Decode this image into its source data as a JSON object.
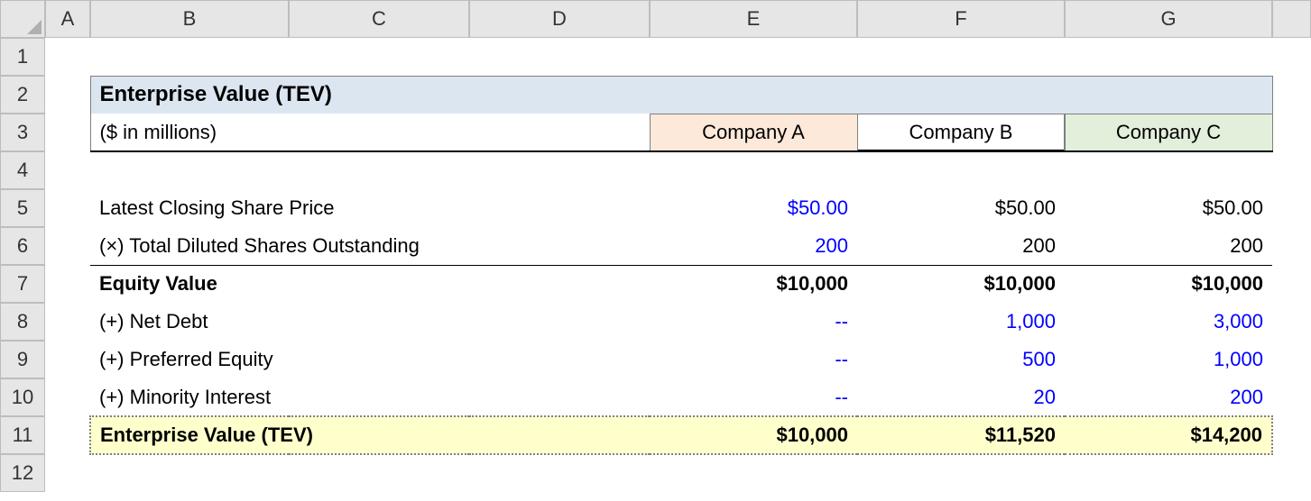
{
  "columns": [
    "A",
    "B",
    "C",
    "D",
    "E",
    "F",
    "G"
  ],
  "row_numbers": [
    "1",
    "2",
    "3",
    "4",
    "5",
    "6",
    "7",
    "8",
    "9",
    "10",
    "11",
    "12"
  ],
  "title": "Enterprise Value (TEV)",
  "subtitle": "($ in millions)",
  "companies": {
    "a": "Company A",
    "b": "Company B",
    "c": "Company C"
  },
  "rows": {
    "share_price": {
      "label": "Latest Closing Share Price",
      "a": "$50.00",
      "b": "$50.00",
      "c": "$50.00"
    },
    "shares": {
      "label": "(×) Total Diluted Shares Outstanding",
      "a": "200",
      "b": "200",
      "c": "200"
    },
    "equity": {
      "label": "Equity Value",
      "a": "$10,000",
      "b": "$10,000",
      "c": "$10,000"
    },
    "netdebt": {
      "label": "(+) Net Debt",
      "a": "--",
      "b": "1,000",
      "c": "3,000"
    },
    "pref": {
      "label": "(+) Preferred Equity",
      "a": "--",
      "b": "500",
      "c": "1,000"
    },
    "minority": {
      "label": "(+) Minority Interest",
      "a": "--",
      "b": "20",
      "c": "200"
    },
    "tev": {
      "label": "Enterprise Value (TEV)",
      "a": "$10,000",
      "b": "$11,520",
      "c": "$14,200"
    }
  },
  "chart_data": {
    "type": "table",
    "title": "Enterprise Value (TEV)",
    "unit": "$ in millions",
    "columns": [
      "Company A",
      "Company B",
      "Company C"
    ],
    "rows": [
      {
        "label": "Latest Closing Share Price",
        "values": [
          50.0,
          50.0,
          50.0
        ],
        "format": "currency2"
      },
      {
        "label": "(×) Total Diluted Shares Outstanding",
        "values": [
          200,
          200,
          200
        ]
      },
      {
        "label": "Equity Value",
        "values": [
          10000,
          10000,
          10000
        ],
        "format": "currency0",
        "bold": true
      },
      {
        "label": "(+) Net Debt",
        "values": [
          null,
          1000,
          3000
        ]
      },
      {
        "label": "(+) Preferred Equity",
        "values": [
          null,
          500,
          1000
        ]
      },
      {
        "label": "(+) Minority Interest",
        "values": [
          null,
          20,
          200
        ]
      },
      {
        "label": "Enterprise Value (TEV)",
        "values": [
          10000,
          11520,
          14200
        ],
        "format": "currency0",
        "bold": true
      }
    ]
  }
}
